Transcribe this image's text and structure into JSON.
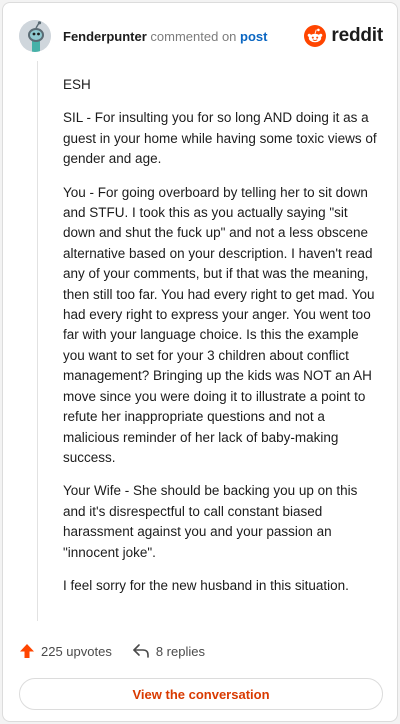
{
  "header": {
    "username": "Fenderpunter",
    "action_text": "commented on",
    "target": "post",
    "brand": "reddit"
  },
  "comment": {
    "paragraphs": [
      "ESH",
      "SIL - For insulting you for so long AND doing it as a guest in your home while having some toxic views of gender and age.",
      "You - For going overboard by telling her to sit down and STFU. I took this as you actually saying \"sit down and shut the fuck up\" and not a less obscene alternative based on your description. I haven't read any of your comments, but if that was the meaning, then still too far. You had every right to get mad. You had every right to express your anger. You went too far with your language choice. Is this the example you want to set for your 3 children about conflict management? Bringing up the kids was NOT an AH move since you were doing it to illustrate a point to refute her inappropriate questions and not a malicious reminder of her lack of baby-making success.",
      "Your Wife - She should be backing you up on this and it's disrespectful to call constant biased harassment against you and your passion an \"innocent joke\".",
      "I feel sorry for the new husband in this situation."
    ]
  },
  "footer": {
    "upvotes": "225 upvotes",
    "replies": "8 replies",
    "view_button": "View the conversation"
  },
  "colors": {
    "brand_orange": "#ff4500",
    "link_blue": "#0a66c2",
    "button_text": "#d93a00"
  },
  "icons": {
    "avatar": "snoo-avatar",
    "brand": "reddit-logo-icon",
    "upvote": "upvote-arrow-icon",
    "reply": "reply-arrow-icon"
  }
}
